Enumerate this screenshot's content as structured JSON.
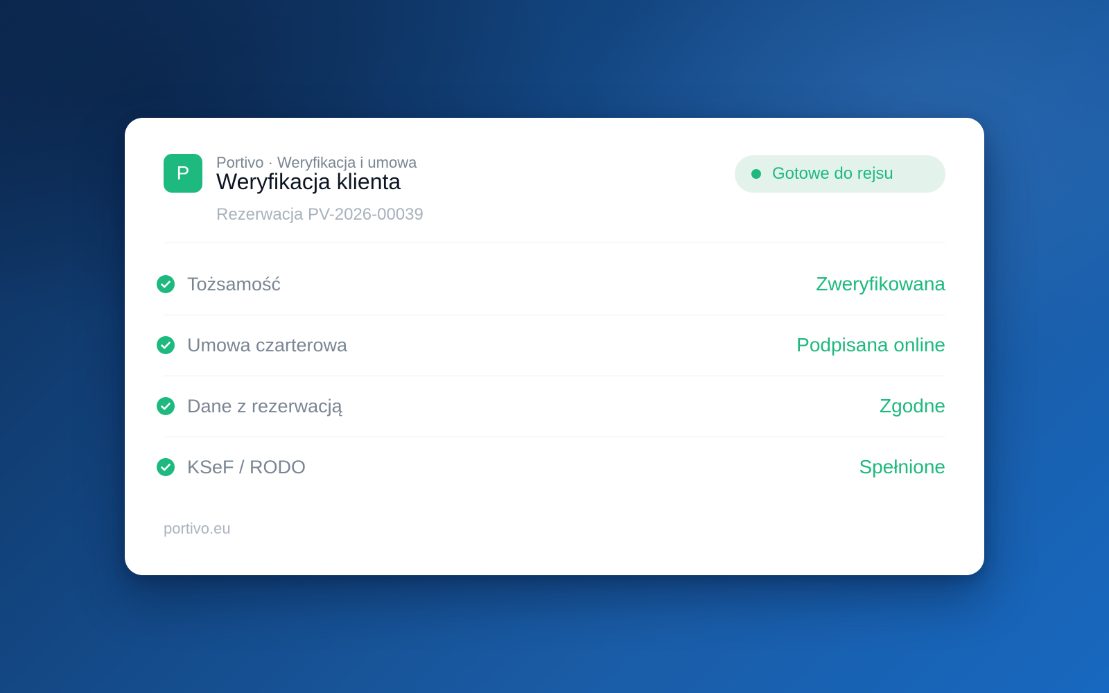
{
  "colors": {
    "accent": "#1db97e",
    "pill_bg": "#e3f3ec",
    "label": "#7a8593",
    "title": "#0c1522",
    "muted": "#a8b2bd"
  },
  "header": {
    "logo_letter": "P",
    "eyebrow": "Portivo · Weryfikacja i umowa",
    "title": "Weryfikacja klienta",
    "subtitle": "Rezerwacja PV-2026-00039"
  },
  "status": {
    "icon": "status-dot",
    "label": "Gotowe do rejsu"
  },
  "checks": [
    {
      "icon": "check-circle-icon",
      "label": "Tożsamość",
      "value": "Zweryfikowana"
    },
    {
      "icon": "check-circle-icon",
      "label": "Umowa czarterowa",
      "value": "Podpisana online"
    },
    {
      "icon": "check-circle-icon",
      "label": "Dane z rezerwacją",
      "value": "Zgodne"
    },
    {
      "icon": "check-circle-icon",
      "label": "KSeF / RODO",
      "value": "Spełnione"
    }
  ],
  "footer": {
    "domain": "portivo.eu"
  }
}
